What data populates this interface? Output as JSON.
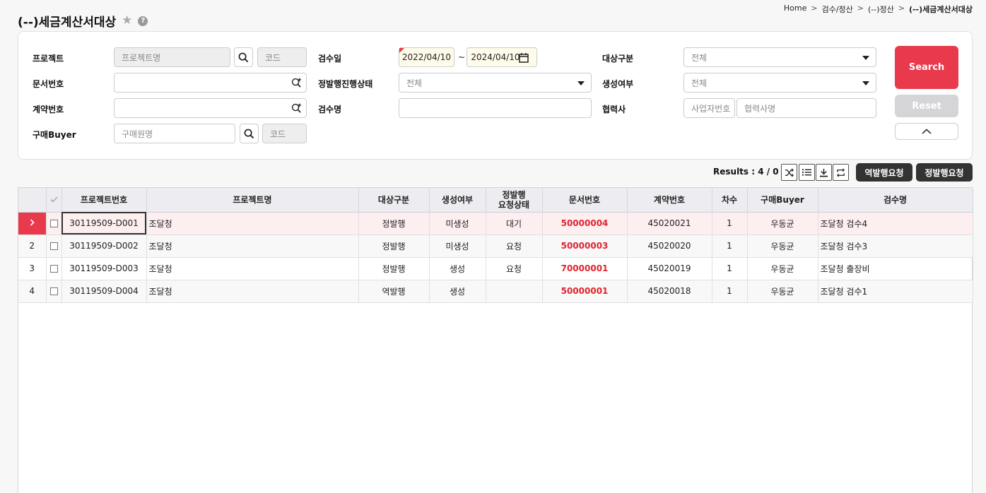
{
  "breadcrumb": {
    "home": "Home",
    "level1": "검수/정산",
    "level2": "(--)정산",
    "current": "(--)세금계산서대상",
    "sep": ">"
  },
  "page": {
    "title": "(--)세금계산서대상",
    "help": "?"
  },
  "filters": {
    "project": {
      "label": "프로젝트",
      "name_placeholder": "프로젝트명",
      "code_placeholder": "코드"
    },
    "doc_no": {
      "label": "문서번호"
    },
    "contract_no": {
      "label": "계약번호"
    },
    "buyer": {
      "label": "구매Buyer",
      "name_placeholder": "구매원명",
      "code_placeholder": "코드"
    },
    "inspect_date": {
      "label": "검수일",
      "from": "2022/04/10",
      "tilde": "~",
      "to": "2024/04/10"
    },
    "issue_status": {
      "label": "정발행진행상태",
      "value": "전체"
    },
    "inspect_name": {
      "label": "검수명"
    },
    "target_type": {
      "label": "대상구분",
      "value": "전체"
    },
    "gen_status": {
      "label": "생성여부",
      "value": "전체"
    },
    "partner": {
      "label": "협력사",
      "biz_placeholder": "사업자번호",
      "name_placeholder": "협력사명"
    }
  },
  "buttons": {
    "search": "Search",
    "reset": "Reset",
    "reverse_issue": "역발행요청",
    "forward_issue": "정발행요청"
  },
  "results": {
    "label": "Results : 4 / 0"
  },
  "grid": {
    "headers": {
      "project_no": "프로젝트번호",
      "project_name": "프로젝트명",
      "target_type": "대상구분",
      "gen_status": "생성여부",
      "issue_status_1": "정발행",
      "issue_status_2": "요청상태",
      "doc_no": "문서번호",
      "contract_no": "계약번호",
      "seq": "차수",
      "buyer": "구매Buyer",
      "inspect_name": "검수명"
    },
    "rows": [
      {
        "num": ">",
        "project_no": "30119509-D001",
        "project_name": "조달청",
        "target_type": "정발행",
        "gen_status": "미생성",
        "issue_status": "대기",
        "doc_no": "50000004",
        "contract_no": "45020021",
        "seq": "1",
        "buyer": "우동균",
        "inspect_name": "조달청 검수4"
      },
      {
        "num": "2",
        "project_no": "30119509-D002",
        "project_name": "조달청",
        "target_type": "정발행",
        "gen_status": "미생성",
        "issue_status": "요청",
        "doc_no": "50000003",
        "contract_no": "45020020",
        "seq": "1",
        "buyer": "우동균",
        "inspect_name": "조달청 검수3"
      },
      {
        "num": "3",
        "project_no": "30119509-D003",
        "project_name": "조달청",
        "target_type": "정발행",
        "gen_status": "생성",
        "issue_status": "요청",
        "doc_no": "70000001",
        "contract_no": "45020019",
        "seq": "1",
        "buyer": "우동균",
        "inspect_name": "조달청 출장비"
      },
      {
        "num": "4",
        "project_no": "30119509-D004",
        "project_name": "조달청",
        "target_type": "역발행",
        "gen_status": "생성",
        "issue_status": "",
        "doc_no": "50000001",
        "contract_no": "45020018",
        "seq": "1",
        "buyer": "우동균",
        "inspect_name": "조달청 검수1"
      }
    ]
  },
  "colors": {
    "accent": "#e83a4c",
    "link_red": "#e0242f",
    "dark_button": "#333333"
  }
}
